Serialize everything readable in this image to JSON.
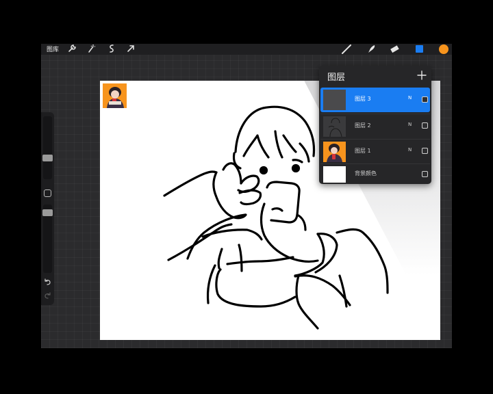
{
  "toolbar": {
    "gallery_label": "图库",
    "left_tools": [
      "wrench-icon",
      "magic-wand-icon",
      "selection-icon",
      "transform-arrow-icon"
    ],
    "right_tools": [
      "brush-icon",
      "smudge-icon",
      "eraser-icon",
      "layers-icon",
      "color-swatch"
    ],
    "accent_color": "#1a7df2",
    "current_color": "#f7941d"
  },
  "layers_panel": {
    "title": "图层",
    "add_button": "+",
    "layers": [
      {
        "name": "图层 3",
        "mode": "N",
        "visible": true,
        "active": true
      },
      {
        "name": "图层 2",
        "mode": "N",
        "visible": true,
        "active": false
      },
      {
        "name": "图层 1",
        "mode": "N",
        "visible": true,
        "active": false
      },
      {
        "name": "背景颜色",
        "mode": "",
        "visible": true,
        "active": false
      }
    ]
  },
  "sidebar": {
    "brush_size_level": 0.35,
    "opacity_level": 0.93
  }
}
